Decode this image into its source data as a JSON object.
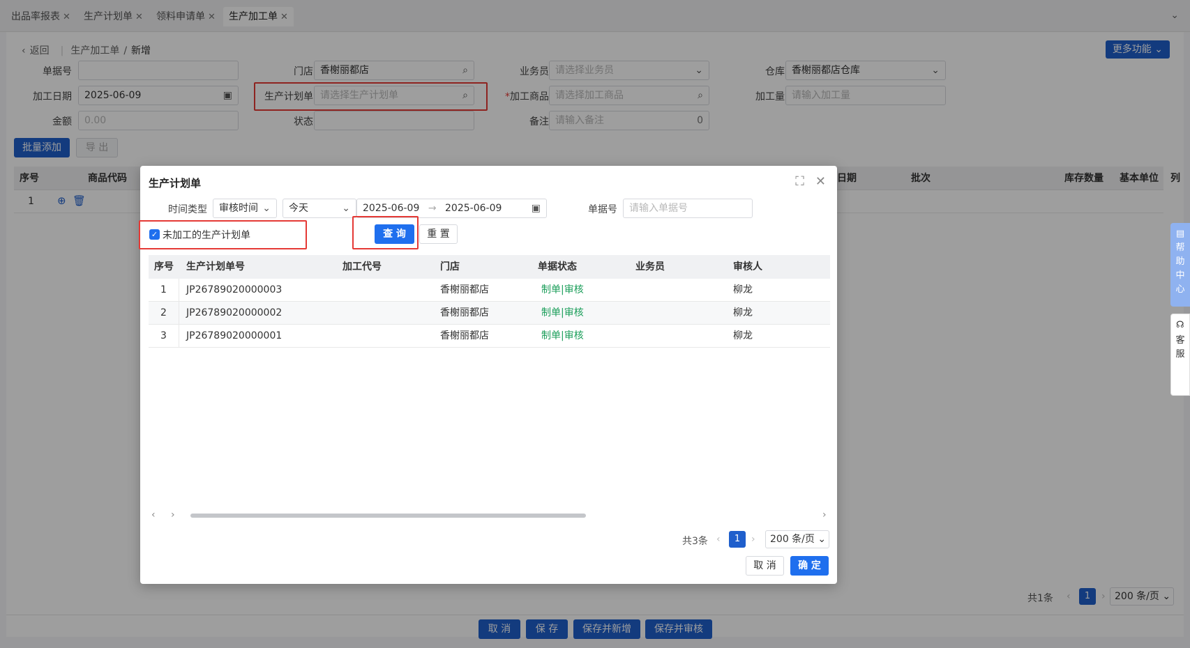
{
  "tabs": [
    {
      "label": "出品率报表",
      "active": false
    },
    {
      "label": "生产计划单",
      "active": false
    },
    {
      "label": "领料申请单",
      "active": false
    },
    {
      "label": "生产加工单",
      "active": true
    }
  ],
  "breadcrumb": {
    "back": "返回",
    "parent": "生产加工单",
    "current": "新增"
  },
  "more_button": "更多功能",
  "form": {
    "doc_no_label": "单据号",
    "store_label": "门店",
    "store_value": "香榭丽都店",
    "staff_label": "业务员",
    "staff_placeholder": "请选择业务员",
    "warehouse_label": "仓库",
    "warehouse_value": "香榭丽都店仓库",
    "date_label": "加工日期",
    "date_value": "2025-06-09",
    "plan_label": "生产计划单",
    "plan_placeholder": "请选择生产计划单",
    "product_label": "加工商品",
    "product_placeholder": "请选择加工商品",
    "qty_label": "加工量",
    "qty_placeholder": "请输入加工量",
    "amount_label": "金额",
    "amount_placeholder": "0.00",
    "status_label": "状态",
    "note_label": "备注",
    "note_placeholder": "请输入备注",
    "note_count": "0"
  },
  "actions": {
    "batch_add": "批量添加",
    "export": "导 出"
  },
  "grid": {
    "headers": [
      "序号",
      "商品代码",
      "日期",
      "批次",
      "库存数量",
      "基本单位",
      "列"
    ],
    "row_index": "1"
  },
  "main_pager": {
    "total": "共1条",
    "page": "1",
    "size": "200 条/页"
  },
  "bottom_buttons": [
    "取 消",
    "保 存",
    "保存并新增",
    "保存并审核"
  ],
  "side": {
    "help": "帮助中心",
    "service": "客服"
  },
  "modal": {
    "title": "生产计划单",
    "time_type_label": "时间类型",
    "time_type_value": "审核时间",
    "range_value": "今天",
    "date_start": "2025-06-09",
    "date_end": "2025-06-09",
    "doc_no_label": "单据号",
    "doc_no_placeholder": "请输入单据号",
    "unprocessed_label": "未加工的生产计划单",
    "query_button": "查 询",
    "reset_button": "重 置",
    "headers": [
      "序号",
      "生产计划单号",
      "加工代号",
      "门店",
      "单据状态",
      "业务员",
      "审核人"
    ],
    "rows": [
      {
        "idx": "1",
        "no": "JP26789020000003",
        "code": "",
        "store": "香榭丽都店",
        "status": "制单|审核",
        "staff": "",
        "auditor": "柳龙"
      },
      {
        "idx": "2",
        "no": "JP26789020000002",
        "code": "",
        "store": "香榭丽都店",
        "status": "制单|审核",
        "staff": "",
        "auditor": "柳龙"
      },
      {
        "idx": "3",
        "no": "JP26789020000001",
        "code": "",
        "store": "香榭丽都店",
        "status": "制单|审核",
        "staff": "",
        "auditor": "柳龙"
      }
    ],
    "pager": {
      "total": "共3条",
      "page": "1",
      "size": "200 条/页"
    },
    "cancel_button": "取 消",
    "ok_button": "确 定"
  },
  "colors": {
    "primary": "#1f5fcc",
    "highlight": "#e53935",
    "status_green": "#1b9e5a"
  }
}
